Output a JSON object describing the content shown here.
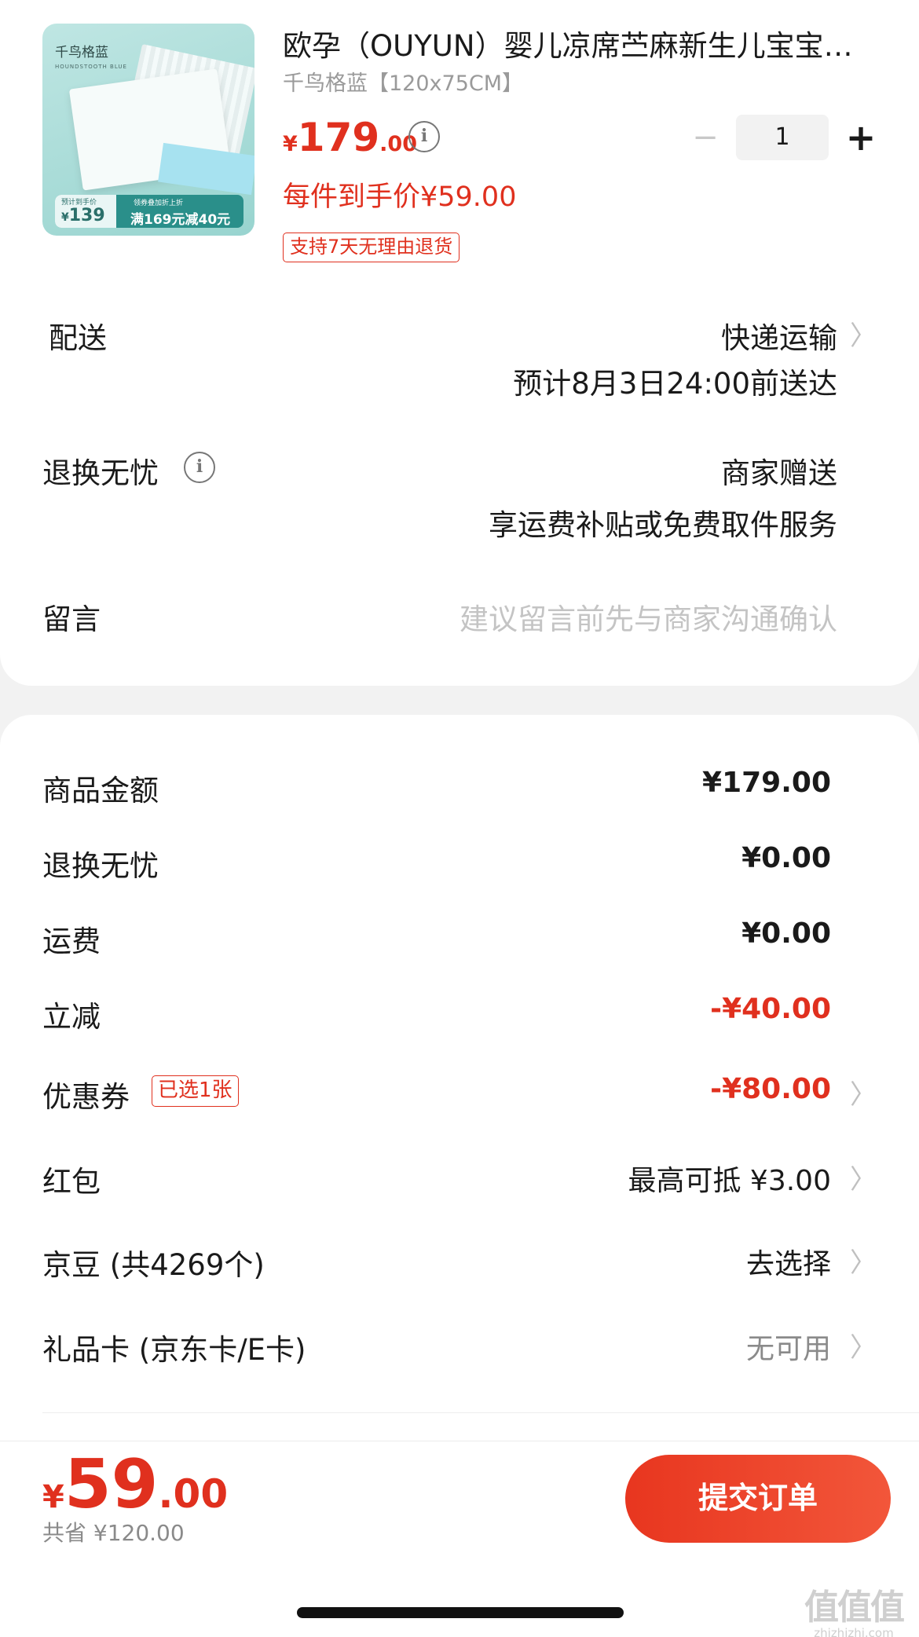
{
  "product": {
    "thumb_label": "千鸟格蓝",
    "thumb_sub": "HOUNDSTOOTH BLUE",
    "thumb_price_label": "预计到手价",
    "thumb_price": "139",
    "thumb_promo_top": "领券叠加折上折",
    "thumb_promo": "满169元减40元",
    "title": "欧孕（OUYUN）婴儿凉席苎麻新生儿宝宝凉席",
    "spec": "千鸟格蓝【120x75CM】",
    "price_symbol": "¥",
    "price_int": "179",
    "price_dec": ".00",
    "per_item": "每件到手价¥59.00",
    "return_tag": "支持7天无理由退货",
    "qty": "1",
    "qty_minus": "−",
    "qty_plus": "+"
  },
  "delivery": {
    "label": "配送",
    "method": "快递运输",
    "eta": "预计8月3日24:00前送达"
  },
  "return_service": {
    "label": "退换无忧",
    "value": "商家赠送",
    "desc": "享运费补贴或免费取件服务"
  },
  "message": {
    "label": "留言",
    "placeholder": "建议留言前先与商家沟通确认"
  },
  "summary": {
    "goods_label": "商品金额",
    "goods_value": "¥179.00",
    "return_label": "退换无忧",
    "return_value": "¥0.00",
    "shipping_label": "运费",
    "shipping_value": "¥0.00",
    "discount_label": "立减",
    "discount_value": "-¥40.00",
    "coupon_label": "优惠券",
    "coupon_tag": "已选1张",
    "coupon_value": "-¥80.00",
    "redpacket_label": "红包",
    "redpacket_value": "最高可抵 ¥3.00",
    "jingdou_label": "京豆 (共4269个)",
    "jingdou_value": "去选择",
    "giftcard_label": "礼品卡 (京东卡/E卡)",
    "giftcard_value": "无可用"
  },
  "footer": {
    "total_symbol": "¥",
    "total_int": "59",
    "total_dec": ".00",
    "saved": "共省 ¥120.00",
    "submit": "提交订单"
  },
  "watermark": {
    "brand": "值值值",
    "site": "zhizhizhi.com"
  },
  "icons": {
    "info": "i",
    "chevron": "〉"
  },
  "colors": {
    "accent": "#e0301e",
    "muted": "#8a8a8a"
  }
}
